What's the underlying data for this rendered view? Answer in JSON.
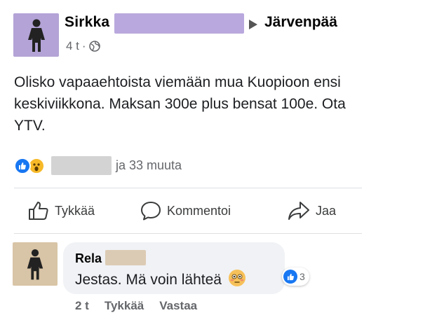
{
  "post": {
    "author": "Sirkka",
    "group": "Järvenpää",
    "time": "4 t",
    "separator": "·",
    "body": "Olisko vapaaehtoista  viemään mua Kuopioon ensi keskiviikkona. Maksan 300e plus bensat 100e. Ota  YTV.",
    "reactions_text": "ja 33 muuta",
    "reaction_types": [
      "like-icon",
      "wow-icon"
    ]
  },
  "actions": {
    "like": "Tykkää",
    "comment": "Kommentoi",
    "share": "Jaa"
  },
  "comment": {
    "author": "Rela",
    "text": "Jestas. Mä voin lähteä",
    "reaction_count": "3",
    "time": "2 t",
    "like": "Tykkää",
    "reply": "Vastaa"
  },
  "colors": {
    "post_avatar_bg": "#b3a3d6",
    "comment_avatar_bg": "#d8c4a6",
    "like_blue": "#1877f2"
  }
}
